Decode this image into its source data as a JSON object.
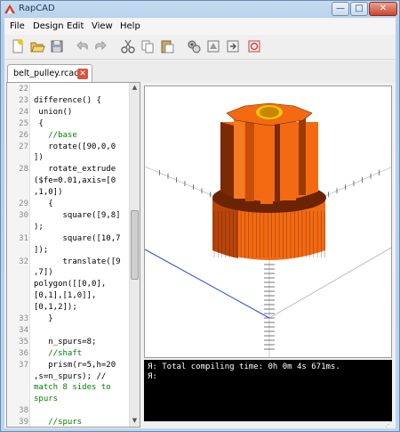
{
  "window": {
    "title": "RapCAD",
    "minimize_label": "—",
    "maximize_label": "□",
    "close_label": "✕"
  },
  "menubar": {
    "items": [
      "File",
      "Design",
      "Edit",
      "View",
      "Help"
    ]
  },
  "toolbar": {
    "buttons": [
      "new-file-icon",
      "open-file-icon",
      "save-icon",
      "undo-icon",
      "redo-icon",
      "cut-icon",
      "copy-icon",
      "paste-icon",
      "compile-icon",
      "render-icon",
      "export-icon",
      "flush-cache-icon"
    ]
  },
  "tabs": [
    {
      "label": "belt_pulley.rcad",
      "close_label": "✕"
    }
  ],
  "editor": {
    "lines": [
      {
        "num": "22",
        "text": ""
      },
      {
        "num": "23",
        "text": "difference() {"
      },
      {
        "num": "24",
        "text": " union()"
      },
      {
        "num": "25",
        "text": " {"
      },
      {
        "num": "26",
        "text": "   //base"
      },
      {
        "num": "27",
        "text": "   rotate([90,0,0"
      },
      {
        "num": "",
        "text": "])"
      },
      {
        "num": "28",
        "text": "   rotate_extrude"
      },
      {
        "num": "",
        "text": "($fe=0.01,axis=[0"
      },
      {
        "num": "",
        "text": ",1,0])"
      },
      {
        "num": "29",
        "text": "   {"
      },
      {
        "num": "30",
        "text": "      square([9,8]"
      },
      {
        "num": "",
        "text": ");"
      },
      {
        "num": "31",
        "text": "      square([10,7"
      },
      {
        "num": "",
        "text": "]);"
      },
      {
        "num": "32",
        "text": "      translate([9"
      },
      {
        "num": "",
        "text": ",7])"
      },
      {
        "num": "",
        "text": "polygon([[0,0],"
      },
      {
        "num": "",
        "text": "[0,1],[1,0]],"
      },
      {
        "num": "",
        "text": "[0,1,2]);"
      },
      {
        "num": "33",
        "text": "   }"
      },
      {
        "num": "34",
        "text": ""
      },
      {
        "num": "35",
        "text": "   n_spurs=8;"
      },
      {
        "num": "36",
        "text": "   //shaft"
      },
      {
        "num": "37",
        "text": "   prism(r=5,h=20"
      },
      {
        "num": "",
        "text": ",s=n_spurs); //"
      },
      {
        "num": "",
        "text": "match 8 sides to"
      },
      {
        "num": "",
        "text": "spurs"
      },
      {
        "num": "38",
        "text": ""
      },
      {
        "num": "39",
        "text": "   //spurs"
      }
    ]
  },
  "console": {
    "lines": [
      "Я: Total compiling time: 0h 0m 4s 671ms.",
      "Я:"
    ]
  },
  "colors": {
    "model_orange": "#f36a12",
    "model_dark": "#7a2a05",
    "axis_blue": "#2a4fd8",
    "comment_green": "#008000"
  }
}
